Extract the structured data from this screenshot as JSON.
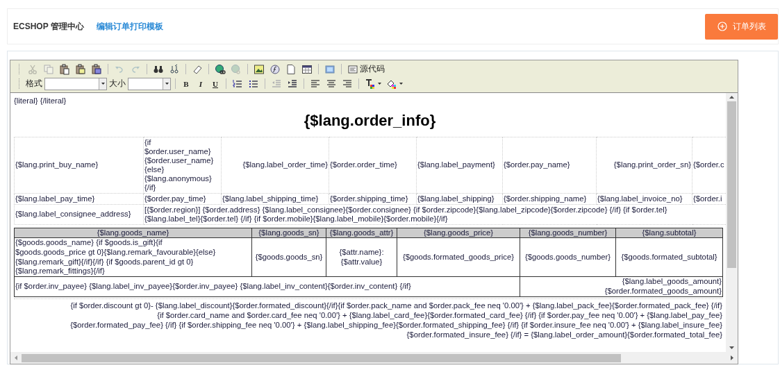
{
  "header": {
    "brand": "ECSHOP 管理中心",
    "link": "编辑订单打印模板",
    "button": "订单列表"
  },
  "toolbar": {
    "rows": [
      {
        "groups": [
          [
            {
              "kind": "cut",
              "disabled": true
            },
            {
              "kind": "copy",
              "disabled": true
            },
            {
              "kind": "paste",
              "disabled": false
            },
            {
              "kind": "paste_text",
              "disabled": false
            },
            {
              "kind": "paste_word",
              "disabled": false
            }
          ],
          [
            {
              "kind": "undo",
              "disabled": true
            },
            {
              "kind": "redo",
              "disabled": true
            }
          ],
          [
            {
              "kind": "find",
              "disabled": false
            },
            {
              "kind": "replace",
              "disabled": false
            }
          ],
          [
            {
              "kind": "eraser",
              "disabled": false
            }
          ],
          [
            {
              "kind": "link",
              "disabled": false
            },
            {
              "kind": "unlink",
              "disabled": true
            }
          ],
          [
            {
              "kind": "image",
              "disabled": false
            },
            {
              "kind": "flash",
              "disabled": false
            },
            {
              "kind": "page",
              "disabled": false
            },
            {
              "kind": "table",
              "disabled": false
            }
          ],
          [
            {
              "kind": "preview",
              "disabled": false
            }
          ],
          [
            {
              "kind": "source",
              "label": "源代码",
              "disabled": false
            }
          ]
        ]
      },
      {
        "groups": [
          [
            {
              "kind": "select",
              "label": "格式"
            },
            {
              "kind": "select_small",
              "label": "大小"
            }
          ],
          [
            {
              "kind": "bold",
              "label": "B",
              "disabled": false
            },
            {
              "kind": "italic",
              "label": "I",
              "disabled": false
            },
            {
              "kind": "underline",
              "label": "U",
              "disabled": false
            }
          ],
          [
            {
              "kind": "ol",
              "disabled": false
            },
            {
              "kind": "ul",
              "disabled": false
            }
          ],
          [
            {
              "kind": "outdent",
              "disabled": true
            },
            {
              "kind": "indent",
              "disabled": false
            }
          ],
          [
            {
              "kind": "align_left",
              "disabled": false
            },
            {
              "kind": "align_center",
              "disabled": false
            },
            {
              "kind": "align_right",
              "disabled": false
            }
          ],
          [
            {
              "kind": "text_color",
              "disabled": false
            },
            {
              "kind": "bg_color",
              "disabled": false
            }
          ]
        ]
      }
    ]
  },
  "editor": {
    "literal": "{literal} {/literal}",
    "title": "{$lang.order_info}",
    "info_rows": [
      [
        "{$lang.print_buy_name}",
        "{if\n$order.user_name}\n{$order.user_name}\n{else}\n{$lang.anonymous}\n{/if}",
        "{$lang.label_order_time}",
        "{$order.order_time}",
        "{$lang.label_payment}",
        "{$order.pay_name}",
        "{$lang.print_order_sn}",
        "{$order.c"
      ],
      [
        "{$lang.label_pay_time}",
        "{$order.pay_time}",
        "{$lang.label_shipping_time}",
        "{$order.shipping_time}",
        "{$lang.label_shipping}",
        "{$order.shipping_name}",
        "{$lang.label_invoice_no}",
        "{$order.i"
      ],
      [
        "{$lang.label_consignee_address}",
        "[{$order.region}] {$order.address}  {$lang.label_consignee}{$order.consignee}  {if $order.zipcode}{$lang.label_zipcode}{$order.zipcode} {/if} {if $order.tel}\n{$lang.label_tel}{$order.tel}  {/if} {if $order.mobile}{$lang.label_mobile}{$order.mobile}{/if}"
      ]
    ],
    "goods_columns": [
      "{$lang.goods_name}",
      "{$lang.goods_sn}",
      "{$lang.goods_attr}",
      "{$lang.goods_price}",
      "{$lang.goods_number}",
      "{$lang.subtotal}"
    ],
    "goods_row": [
      " {$goods.goods_name} {if $goods.is_gift}{if\n$goods.goods_price gt 0}{$lang.remark_favourable}{else}\n{$lang.remark_gift}{/if}{/if} {if $goods.parent_id gt 0}\n{$lang.remark_fittings}{/if}",
      "{$goods.goods_sn}",
      "{$attr.name}:\n{$attr.value}",
      "{$goods.formated_goods_price}",
      "{$goods.goods_number}",
      "{$goods.formated_subtotal}"
    ],
    "invoice": "{if $order.inv_payee} {$lang.label_inv_payee}{$order.inv_payee}    {$lang.label_inv_content}{$order.inv_content} {/if}",
    "goods_amount": "{$lang.label_goods_amount}\n{$order.formated_goods_amount}",
    "fee_lines": [
      "{if $order.discount gt 0}- {$lang.label_discount}{$order.formated_discount}{/if}{if $order.pack_name and $order.pack_fee neq '0.00'} + {$lang.label_pack_fee}{$order.formated_pack_fee} {/if}",
      "{if $order.card_name and $order.card_fee neq '0.00'} + {$lang.label_card_fee}{$order.formated_card_fee} {/if} {if $order.pay_fee neq '0.00'} + {$lang.label_pay_fee}",
      "{$order.formated_pay_fee} {/if} {if $order.shipping_fee neq '0.00'} + {$lang.label_shipping_fee}{$order.formated_shipping_fee} {/if} {if $order.insure_fee neq '0.00'} + {$lang.label_insure_fee}",
      "{$order.formated_insure_fee} {/if} = {$lang.label_order_amount}{$order.formated_total_fee}"
    ]
  }
}
